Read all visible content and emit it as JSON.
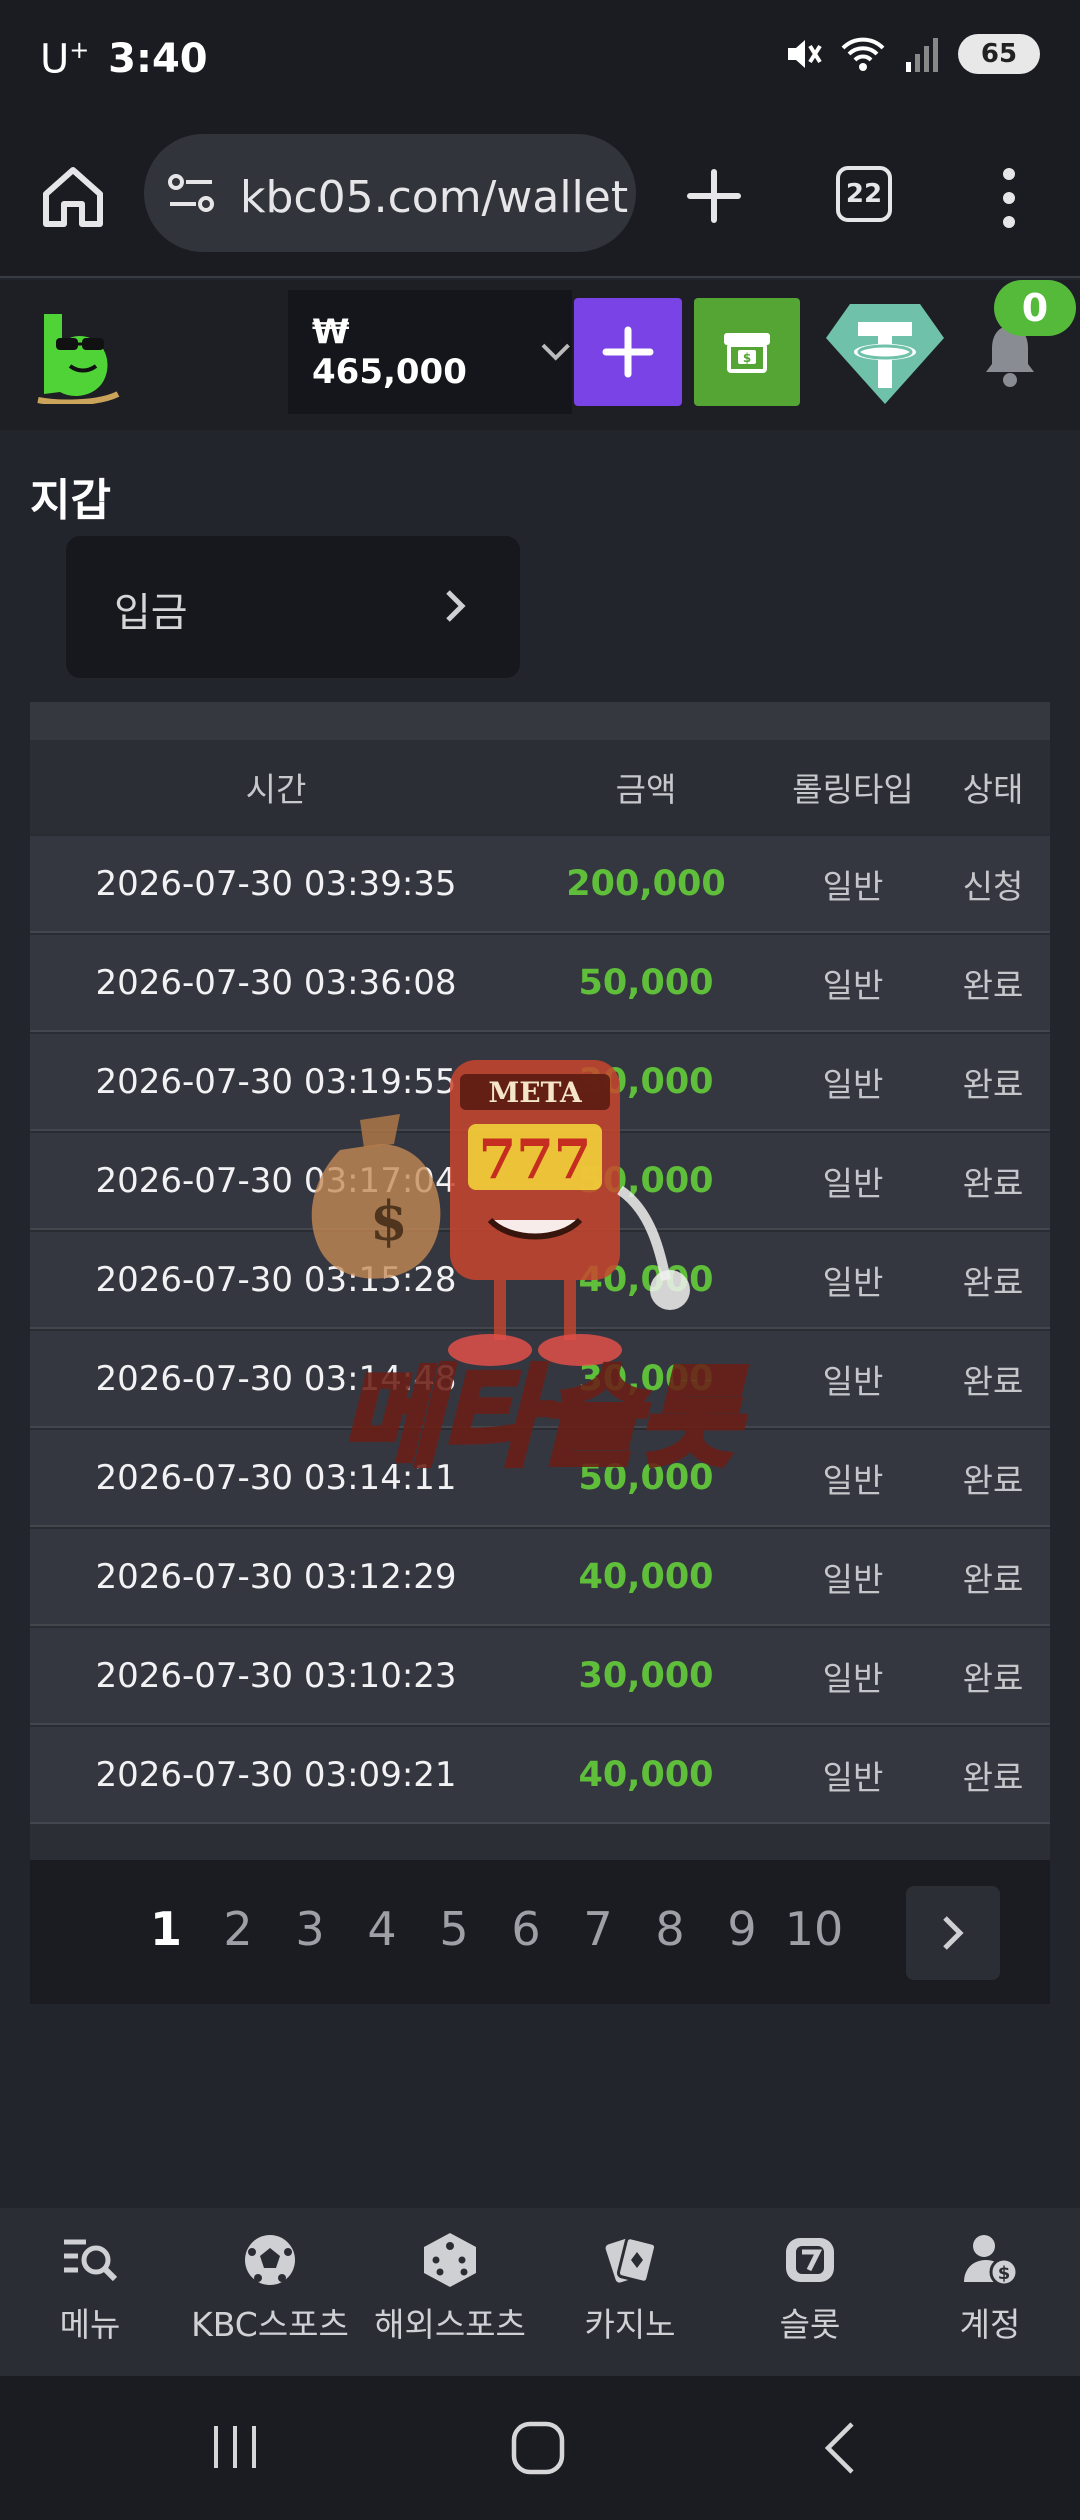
{
  "status_bar": {
    "carrier": "U",
    "carrier_sup": "+",
    "time": "3:40",
    "battery": "65"
  },
  "browser": {
    "url": "kbc05.com/wallet",
    "tab_count": "22"
  },
  "header": {
    "balance": "₩ 465,000",
    "notification_count": "0"
  },
  "page": {
    "title": "지갑",
    "deposit_tab_label": "입금"
  },
  "table": {
    "headers": [
      "시간",
      "금액",
      "롤링타입",
      "상태"
    ],
    "rows": [
      {
        "time": "2026-07-30 03:39:35",
        "amount": "200,000",
        "rolling": "일반",
        "status": "신청"
      },
      {
        "time": "2026-07-30 03:36:08",
        "amount": "50,000",
        "rolling": "일반",
        "status": "완료"
      },
      {
        "time": "2026-07-30 03:19:55",
        "amount": "30,000",
        "rolling": "일반",
        "status": "완료"
      },
      {
        "time": "2026-07-30 03:17:04",
        "amount": "50,000",
        "rolling": "일반",
        "status": "완료"
      },
      {
        "time": "2026-07-30 03:15:28",
        "amount": "40,000",
        "rolling": "일반",
        "status": "완료"
      },
      {
        "time": "2026-07-30 03:14:48",
        "amount": "30,000",
        "rolling": "일반",
        "status": "완료"
      },
      {
        "time": "2026-07-30 03:14:11",
        "amount": "50,000",
        "rolling": "일반",
        "status": "완료"
      },
      {
        "time": "2026-07-30 03:12:29",
        "amount": "40,000",
        "rolling": "일반",
        "status": "완료"
      },
      {
        "time": "2026-07-30 03:10:23",
        "amount": "30,000",
        "rolling": "일반",
        "status": "완료"
      },
      {
        "time": "2026-07-30 03:09:21",
        "amount": "40,000",
        "rolling": "일반",
        "status": "완료"
      }
    ]
  },
  "pagination": {
    "pages": [
      "1",
      "2",
      "3",
      "4",
      "5",
      "6",
      "7",
      "8",
      "9",
      "10"
    ],
    "current": "1"
  },
  "watermark": {
    "sign_text": "META",
    "slot_text": "777",
    "title": "메타슬롯"
  },
  "bottom_nav": [
    {
      "label": "메뉴",
      "icon": "menu-search-icon"
    },
    {
      "label": "KBC스포츠",
      "icon": "soccer-ball-icon"
    },
    {
      "label": "해외스포츠",
      "icon": "dice-icon"
    },
    {
      "label": "카지노",
      "icon": "cards-icon"
    },
    {
      "label": "슬롯",
      "icon": "slot-seven-icon"
    },
    {
      "label": "계정",
      "icon": "account-icon"
    }
  ],
  "colors": {
    "amount_green": "#5fbf3a",
    "deposit_purple": "#7a43e6",
    "wallet_green": "#55a534",
    "tether_teal": "#50af95"
  }
}
